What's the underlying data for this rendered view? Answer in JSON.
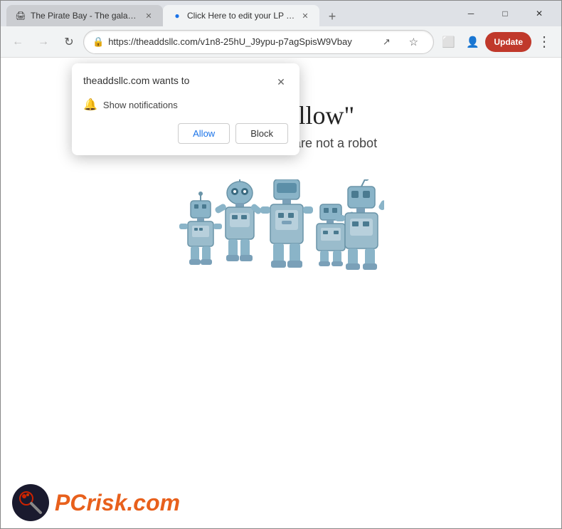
{
  "window": {
    "title": "Browser Window",
    "controls": {
      "minimize": "─",
      "maximize": "□",
      "close": "✕"
    }
  },
  "tabs": [
    {
      "id": "tab1",
      "title": "The Pirate Bay - The galaxy's m",
      "favicon": "🖨",
      "active": false
    },
    {
      "id": "tab2",
      "title": "Click Here to edit your LP title",
      "favicon": "🔵",
      "active": true
    }
  ],
  "new_tab_label": "+",
  "toolbar": {
    "back_title": "Back",
    "forward_title": "Forward",
    "reload_title": "Reload",
    "address": "https://theaddsllc.com/v1n8-25hU_J9ypu-p7agSpisW9Vbay",
    "address_display": "https://theaddsllc.com/v1n8-25hU_J9ypu-p7agSpisW9Vbay",
    "share_icon": "↗",
    "bookmark_icon": "☆",
    "extensions_icon": "⬜",
    "profile_icon": "👤",
    "update_button": "Update",
    "more_icon": "⋮"
  },
  "popup": {
    "title": "theaddsllc.com wants to",
    "permission_text": "Show notifications",
    "allow_label": "Allow",
    "block_label": "Block",
    "close_label": "✕"
  },
  "page": {
    "heading": "Click \"Allow\"",
    "subtext": "to confirm that you are not a robot"
  },
  "footer": {
    "brand": "PC",
    "brand_suffix": "risk.com"
  }
}
